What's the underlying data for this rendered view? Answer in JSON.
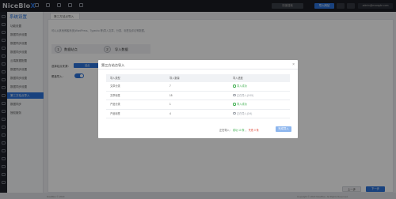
{
  "app": {
    "logo_main": "NiceBlo",
    "logo_accent": "X"
  },
  "topbar": {
    "search_label": "快速搜索",
    "import_label": "导入网站",
    "user_label": "admin@example.com",
    "icons": [
      "monitor-icon",
      "box-icon",
      "refresh-icon",
      "link-icon",
      "edit-icon"
    ]
  },
  "rail_icons": [
    "home-icon",
    "grid-icon",
    "list-icon",
    "chart-icon",
    "cloud-icon",
    "user-icon",
    "flag-icon",
    "lock-icon",
    "tag-icon",
    "folder-icon",
    "mail-icon",
    "gear-icon",
    "shield-icon",
    "key-icon",
    "box-icon",
    "link-icon",
    "star-icon",
    "clock-icon",
    "bell-icon",
    "doc-icon",
    "tool-icon",
    "info-icon"
  ],
  "sidemenu": {
    "title": "系统设置",
    "items": [
      {
        "label": "功能设置",
        "active": false
      },
      {
        "label": "数据同步设置",
        "active": false
      },
      {
        "label": "数据同步设置",
        "active": false
      },
      {
        "label": "数据同步设置",
        "active": false
      },
      {
        "label": "云端数据配置",
        "active": false
      },
      {
        "label": "数据同步设置",
        "active": false
      },
      {
        "label": "数据同步设置",
        "active": false
      },
      {
        "label": "数据同步设置",
        "active": false
      },
      {
        "label": "第三方站点导入",
        "active": true
      },
      {
        "label": "数据同步",
        "active": false
      },
      {
        "label": "授权服务",
        "active": false
      }
    ]
  },
  "content": {
    "tab_label": "第三方站点导入",
    "hint": "可以从其他博客系统(WordPress、Typecho 等)导入文章、分类、标签及评论等数据。",
    "step1_num": "1",
    "step1_label": "数据站点",
    "step2_num": "2",
    "step2_label": "导入数据",
    "form_label_1": "选择站点来源：",
    "form_value_1": "站点",
    "form_label_2": "覆盖导入：",
    "prev_label": "上一步",
    "next_label": "下一步"
  },
  "footer": {
    "left": "NiceBlox © 2023",
    "right": "Copyright © 2023 NiceBlox. All Rights Reserved."
  },
  "modal": {
    "title": "第三方站点导入",
    "columns": [
      "导入类型",
      "导入数量",
      "导入进度"
    ],
    "rows": [
      {
        "type": "文章分类",
        "count": "7",
        "status": "导入成功",
        "state": "ok"
      },
      {
        "type": "文章标签",
        "count": "15",
        "status": "正在导入(0/15)",
        "state": "pending"
      },
      {
        "type": "产品分类",
        "count": "1",
        "status": "导入成功",
        "state": "ok"
      },
      {
        "type": "产品标签",
        "count": "4",
        "status": "正在导入(0/4)",
        "state": "pending"
      }
    ],
    "summary_prefix": "正在导入：",
    "summary_success": "成功 10 条",
    "summary_fail": "失败 0 条",
    "confirm_label": "完成导入"
  },
  "colors": {
    "accent": "#2b73d9",
    "success": "#3cae4d",
    "danger": "#e04a3a",
    "topbar": "#1a1d24"
  }
}
